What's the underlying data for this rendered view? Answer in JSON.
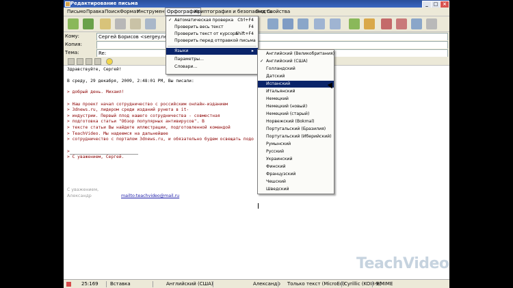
{
  "window": {
    "title": "Редактирование письма"
  },
  "menubar": {
    "items": [
      "Письмо",
      "Правка",
      "Поиск",
      "Формат",
      "Инструменты",
      "Орфография",
      "Криптография и безопасность",
      "Вид",
      "Свойства"
    ]
  },
  "headers": {
    "to_label": "Кому:",
    "to_value": "Сергей Борисов <sergey.neilod@...",
    "cc_label": "Копия:",
    "cc_value": "",
    "subject_label": "Тема:",
    "subject_value": "Re:"
  },
  "body": {
    "lines": [
      "Здравствуйте, Сергей!",
      "В среду, 29 декабря, 2009, 2:48:01 PM, Вы писали:",
      "> добрый день. Михаил!",
      "> Наш проект начал сотрудничество с российским онлайн-изданием",
      "> 3dnews.ru, лидером среди изданий рунета в it-",
      "> индустрии. Первый плод нашего сотрудничества - совместная",
      "> подготовка статьи \"Обзор популярных антивирусов\". В",
      "> тексте статьи Вы найдете иллюстрации, подготовленной командой",
      "> TeachVideo. Мы надеемся на дальнейшее",
      "> сотрудничество с порталом 3dnews.ru, и обязательно будем освещать подо",
      ">",
      "> С уважением, Сергей."
    ],
    "signature_1": "С уважением,",
    "signature_2": "Александр",
    "email": "mailto:teachvideo@mail.ru"
  },
  "spelling_menu": {
    "items": [
      {
        "label": "Автоматическая проверка",
        "shortcut": "Ctrl+F4",
        "checked": true
      },
      {
        "label": "Проверить весь текст",
        "shortcut": "F4"
      },
      {
        "label": "Проверить текст от курсора",
        "shortcut": "Shift+F4"
      },
      {
        "label": "Проверить перед отправкой письма",
        "shortcut": ""
      },
      {
        "label": "Языки",
        "shortcut": "",
        "submenu": true
      },
      {
        "label": "Параметры...",
        "shortcut": ""
      },
      {
        "label": "Словари...",
        "shortcut": ""
      }
    ]
  },
  "languages_menu": {
    "items": [
      "Английский (Великобритания)",
      "Английский (США)",
      "Голландский",
      "Датский",
      "Испанский",
      "Итальянский",
      "Немецкий",
      "Немецкий (новый)",
      "Немецкий (старый)",
      "Норвежский (Bokmal)",
      "Португальский (Бразилия)",
      "Португальский (Иберийский)",
      "Румынский",
      "Русский",
      "Украинский",
      "Финский",
      "Французский",
      "Чешский",
      "Шведский"
    ],
    "checked": "Английский (США)",
    "highlighted": "Испанский"
  },
  "statusbar": {
    "position": "25:169",
    "mode": "Вставка",
    "language": "Английский (США)",
    "account": "Александр",
    "format": "Только текст (MicrоEd)",
    "charset": "Cyrillic (KOI8-R)",
    "security": "S/MIME"
  },
  "watermark": "TeachVideo",
  "colors": {
    "menu_highlight": "#0a246a",
    "title_bar": "#2a4f9a",
    "quote": "#8b0000"
  }
}
